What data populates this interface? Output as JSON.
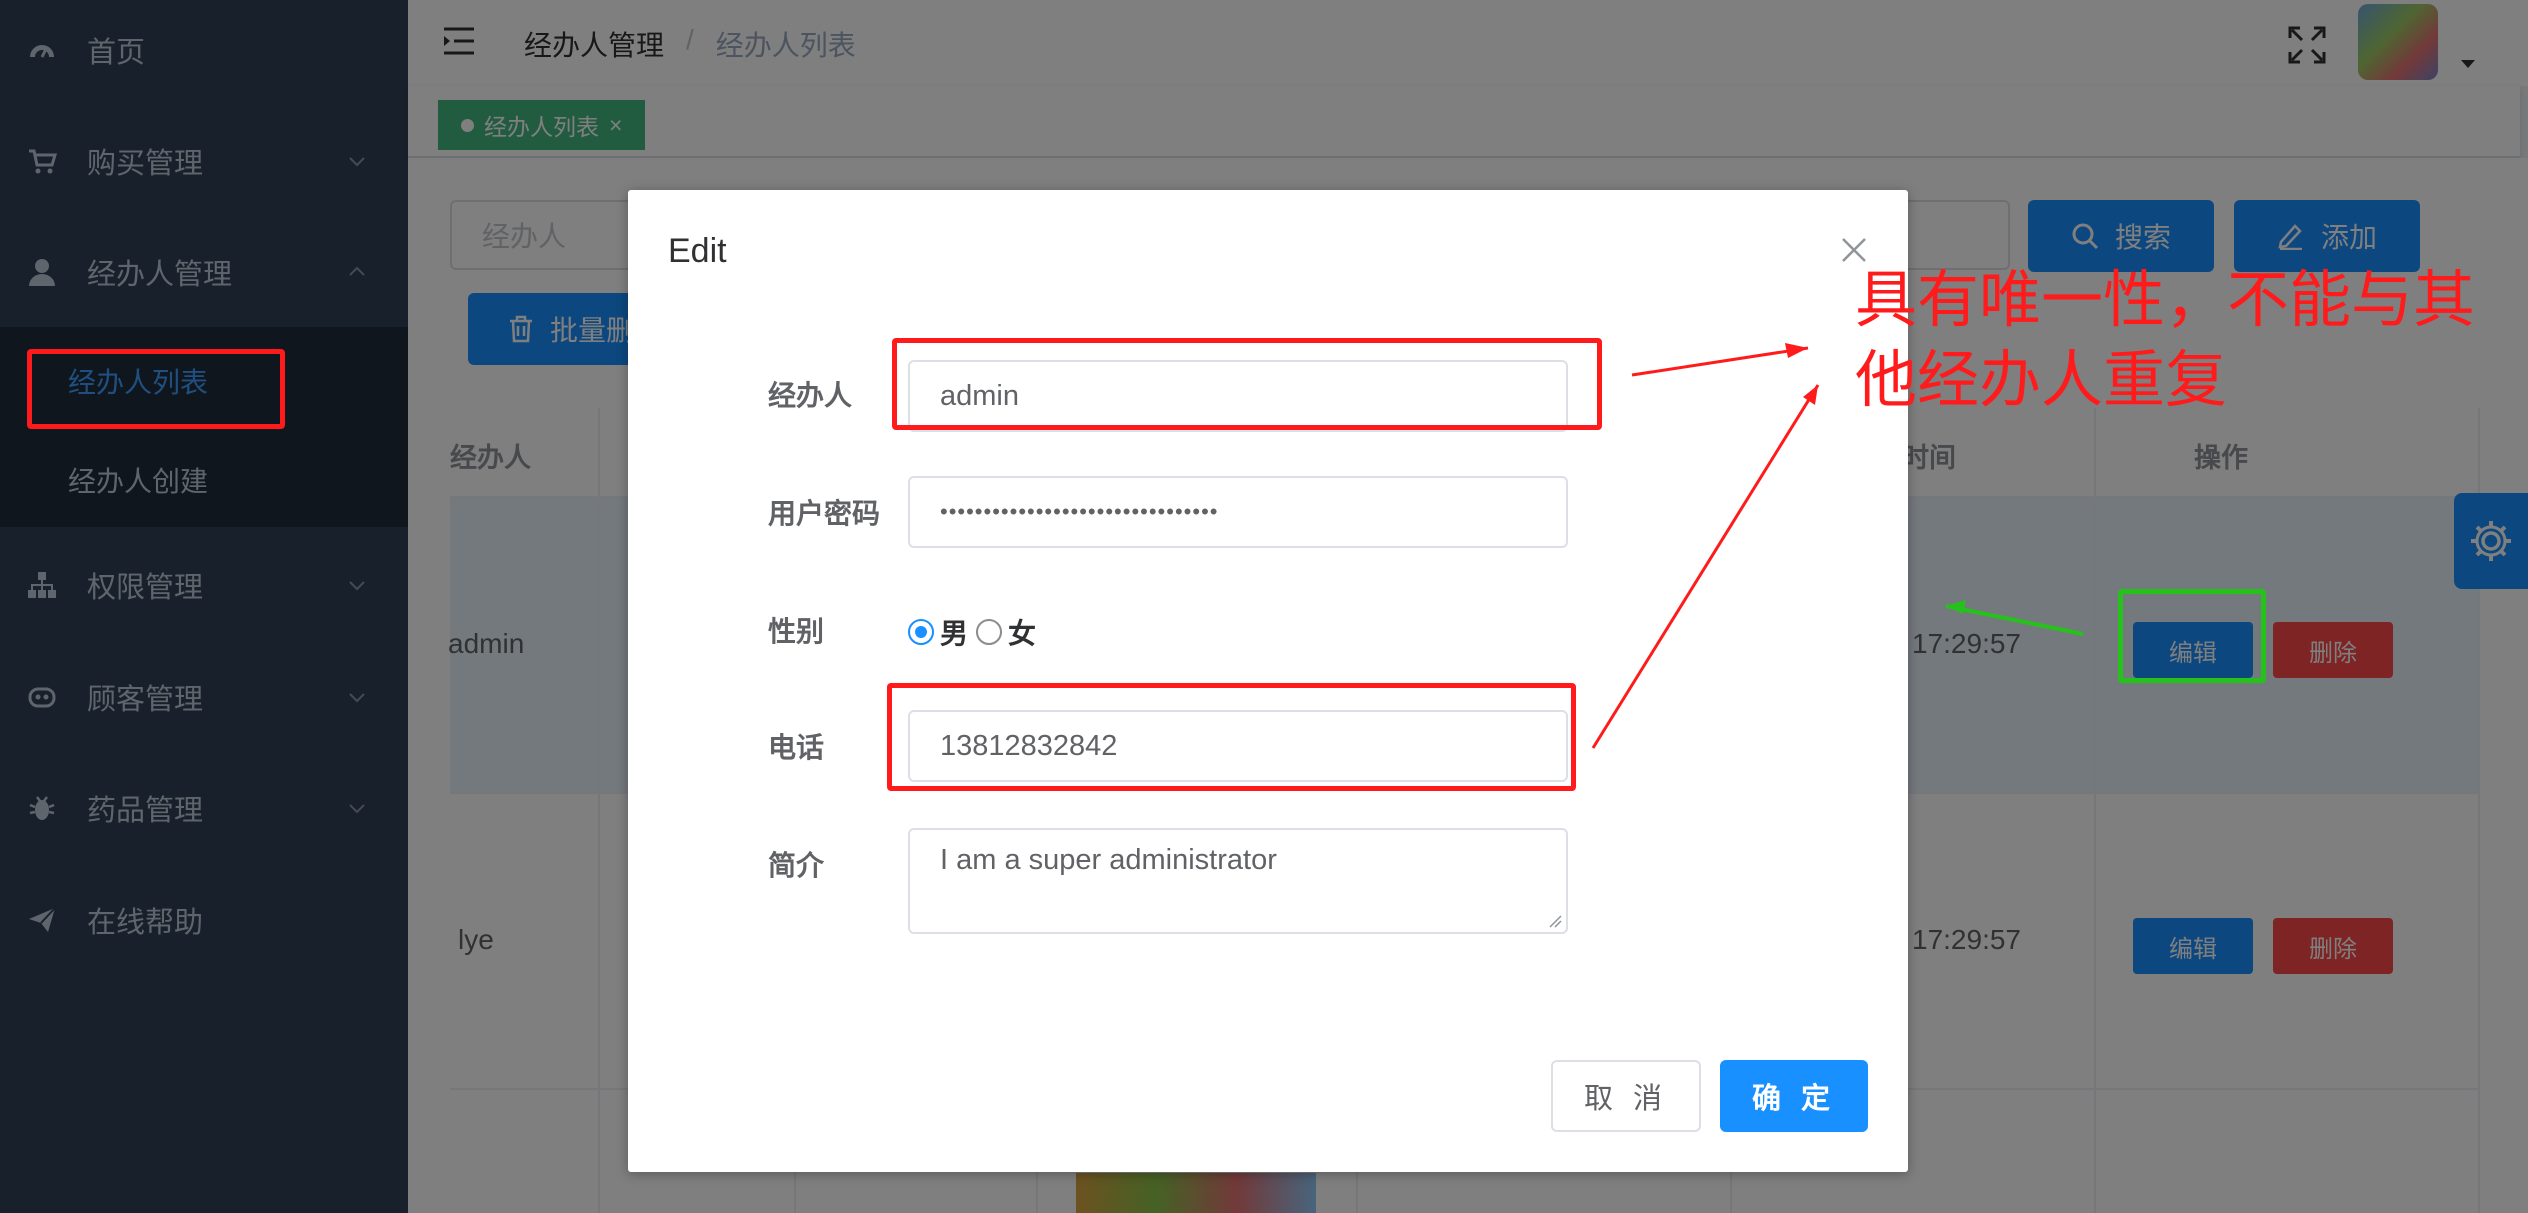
{
  "sidebar": {
    "items": [
      {
        "label": "首页",
        "icon": "dashboard-icon"
      },
      {
        "label": "购买管理",
        "icon": "cart-icon"
      },
      {
        "label": "经办人管理",
        "icon": "user-icon"
      },
      {
        "label": "权限管理",
        "icon": "tree-icon"
      },
      {
        "label": "顾客管理",
        "icon": "robot-icon"
      },
      {
        "label": "药品管理",
        "icon": "bug-icon"
      },
      {
        "label": "在线帮助",
        "icon": "send-icon"
      }
    ],
    "submenu": [
      {
        "label": "经办人列表",
        "active": true
      },
      {
        "label": "经办人创建",
        "active": false
      }
    ]
  },
  "header": {
    "breadcrumb": [
      "经办人管理",
      "/",
      "经办人列表"
    ]
  },
  "tags": [
    {
      "label": "经办人列表",
      "close": "×"
    }
  ],
  "toolbar": {
    "filter_placeholder": "经办人",
    "search_label": "搜索",
    "add_label": "添加",
    "batch_delete_label": "批量删"
  },
  "table": {
    "headers": {
      "col1": "经办人",
      "time": "时间",
      "actions": "操作"
    },
    "rows": [
      {
        "name": "admin",
        "time": "17:29:57",
        "edit": "编辑",
        "delete": "删除"
      },
      {
        "name": "lye",
        "time": "17:29:57",
        "edit": "编辑",
        "delete": "删除"
      }
    ]
  },
  "dialog": {
    "title": "Edit",
    "fields": {
      "agent_label": "经办人",
      "agent_value": "admin",
      "password_label": "用户密码",
      "password_value": "••••••••••••••••••••••••••••••••",
      "gender_label": "性别",
      "gender_options": [
        "男",
        "女"
      ],
      "gender_selected": "男",
      "phone_label": "电话",
      "phone_value": "13812832842",
      "bio_label": "简介",
      "bio_value": "I am a super administrator"
    },
    "cancel_label": "取 消",
    "confirm_label": "确 定"
  },
  "annotation": {
    "text": "具有唯一性，不能与其他经办人重复"
  },
  "colors": {
    "sidebar_bg": "#304156",
    "primary": "#1890ff",
    "danger": "#ff4949",
    "tag_green": "#42b983",
    "annotation_red": "#ff1b1b",
    "annotation_green": "#26c21c"
  }
}
